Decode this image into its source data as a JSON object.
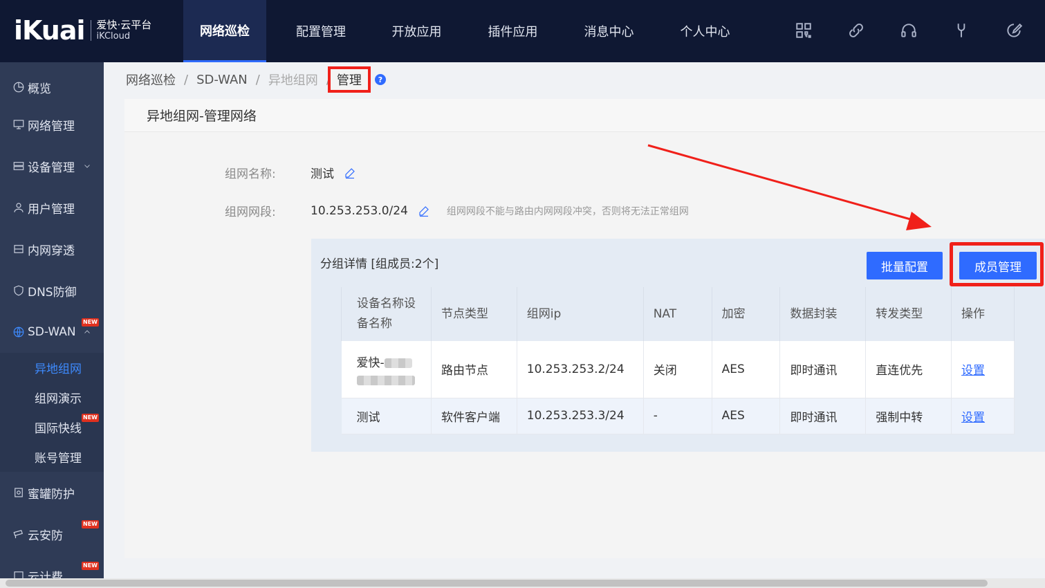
{
  "brand": {
    "logo": "iKuai",
    "title": "爱快·云平台",
    "subtitle": "iKCloud"
  },
  "topnav": [
    "网络巡检",
    "配置管理",
    "开放应用",
    "插件应用",
    "消息中心",
    "个人中心"
  ],
  "top_icons": [
    "grid-icon",
    "link-icon",
    "headset-icon",
    "tool-icon",
    "edit-circle-icon"
  ],
  "sidebar": {
    "items": [
      {
        "label": "概览",
        "icon": "pie-icon"
      },
      {
        "label": "网络管理",
        "icon": "monitor-icon"
      },
      {
        "label": "设备管理",
        "icon": "server-icon"
      },
      {
        "label": "用户管理",
        "icon": "user-icon"
      },
      {
        "label": "内网穿透",
        "icon": "tunnel-icon"
      },
      {
        "label": "DNS防御",
        "icon": "shield-icon"
      },
      {
        "label": "SD-WAN",
        "icon": "globe-icon",
        "badge": "NEW"
      }
    ],
    "sub": [
      {
        "label": "异地组网"
      },
      {
        "label": "组网演示"
      },
      {
        "label": "国际快线",
        "badge": "NEW"
      },
      {
        "label": "账号管理"
      }
    ],
    "more": [
      {
        "label": "蜜罐防护",
        "icon": "honeypot-icon"
      },
      {
        "label": "云安防",
        "icon": "camera-icon",
        "badge": "NEW"
      },
      {
        "label": "云计费",
        "icon": "billing-icon",
        "badge": "NEW"
      }
    ]
  },
  "breadcrumb": {
    "b1": "网络巡检",
    "b2": "SD-WAN",
    "b3": "异地组网",
    "current": "管理",
    "sep": "/"
  },
  "page": {
    "header": "异地组网-管理网络",
    "name_label": "组网名称:",
    "name_value": "测试",
    "segment_label": "组网网段:",
    "segment_value": "10.253.253.0/24",
    "segment_hint": "组网网段不能与路由内网网段冲突，否则将无法正常组网"
  },
  "group": {
    "title": "分组详情 [组成员:2个]",
    "btn_batch": "批量配置",
    "btn_members": "成员管理",
    "columns": [
      "设备名称设备名称",
      "节点类型",
      "组网ip",
      "NAT",
      "加密",
      "数据封装",
      "转发类型",
      "操作"
    ],
    "rows": [
      {
        "name": "爱快-",
        "type": "路由节点",
        "ip": "10.253.253.2/24",
        "nat": "关闭",
        "enc": "AES",
        "encap": "即时通讯",
        "fwd": "直连优先",
        "op": "设置"
      },
      {
        "name": "测试",
        "type": "软件客户端",
        "ip": "10.253.253.3/24",
        "nat": "-",
        "enc": "AES",
        "encap": "即时通讯",
        "fwd": "强制中转",
        "op": "设置"
      }
    ]
  },
  "colors": {
    "topbar": "#0f1833",
    "sidebar": "#2f3b56",
    "accent": "#2f6bff",
    "annotation": "#f0201a"
  }
}
